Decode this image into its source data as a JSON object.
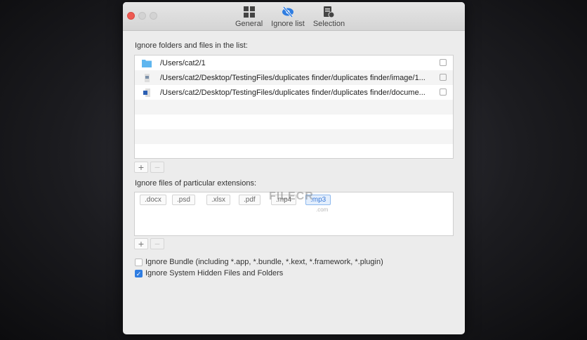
{
  "toolbar": {
    "tabs": [
      {
        "label": "General",
        "icon": "grid-icon"
      },
      {
        "label": "Ignore list",
        "icon": "eye-slash-icon",
        "active": true
      },
      {
        "label": "Selection",
        "icon": "checklist-icon"
      }
    ]
  },
  "folders": {
    "label": "Ignore folders and files in the list:",
    "items": [
      {
        "path": "/Users/cat2/1",
        "icon": "folder-icon"
      },
      {
        "path": "/Users/cat2/Desktop/TestingFiles/duplicates finder/duplicates finder/image/1...",
        "icon": "image-file-icon"
      },
      {
        "path": "/Users/cat2/Desktop/TestingFiles/duplicates finder/duplicates finder/docume...",
        "icon": "word-file-icon"
      }
    ],
    "add": "+",
    "remove": "−"
  },
  "extensions": {
    "label": "Ignore files of particular extensions:",
    "items": [
      ".docx",
      ".psd",
      ".xlsx",
      ".pdf",
      ".mp4",
      ".mp3"
    ],
    "selected": ".mp3",
    "add": "+",
    "remove": "−"
  },
  "options": [
    {
      "label": "Ignore Bundle (including *.app, *.bundle, *.kext, *.framework, *.plugin)",
      "checked": false
    },
    {
      "label": "Ignore System Hidden Files and Folders",
      "checked": true
    }
  ],
  "watermark": {
    "text": "FILECR",
    "sub": ".com"
  },
  "colors": {
    "accent": "#2f7de1",
    "close": "#ee5a52"
  }
}
